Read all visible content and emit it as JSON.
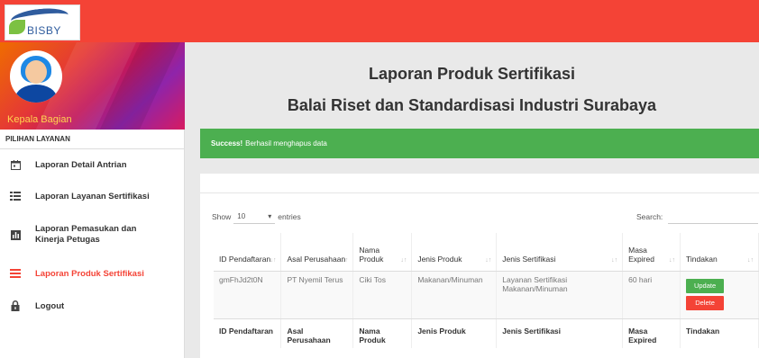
{
  "header": {
    "logo_text": "BISBY"
  },
  "sidebar": {
    "user_name": "Kepala Bagian",
    "section_title": "PILIHAN LAYANAN",
    "items": [
      {
        "label": "Laporan Detail Antrian",
        "icon": "calendar-icon"
      },
      {
        "label": "Laporan Layanan Sertifikasi",
        "icon": "list-icon"
      },
      {
        "label": "Laporan Pemasukan dan Kinerja Petugas",
        "icon": "bar-chart-icon"
      },
      {
        "label": "Laporan Produk Sertifikasi",
        "icon": "list-icon",
        "active": true
      },
      {
        "label": "Logout",
        "icon": "lock-icon"
      }
    ]
  },
  "main": {
    "title_line1": "Laporan Produk Sertifikasi",
    "title_line2": "Balai Riset dan Standardisasi Industri Surabaya",
    "alert": {
      "strong": "Success!",
      "message": "Berhasil menghapus data"
    },
    "table": {
      "show_label": "Show",
      "show_value": "10",
      "entries_label": "entries",
      "search_label": "Search:",
      "headers": [
        "ID Pendaftaran",
        "Asal Perusahaan",
        "Nama Produk",
        "Jenis Produk",
        "Jenis Sertifikasi",
        "Masa Expired",
        "Tindakan"
      ],
      "rows": [
        {
          "id": "gmFhJd2t0N",
          "asal": "PT Nyemil Terus",
          "nama": "Ciki Tos",
          "jenis_produk": "Makanan/Minuman",
          "jenis_sertifikasi": "Layanan Sertifikasi Makanan/Minuman",
          "masa": "60 hari",
          "update_label": "Update",
          "delete_label": "Delete"
        }
      ],
      "footers": [
        "ID Pendaftaran",
        "Asal Perusahaan",
        "Nama Produk",
        "Jenis Produk",
        "Jenis Sertifikasi",
        "Masa Expired",
        "Tindakan"
      ]
    }
  },
  "colors": {
    "topbar": "#f44336",
    "alert": "#4caf50",
    "active_menu": "#f44336",
    "update": "#4caf50",
    "delete": "#f44336"
  }
}
